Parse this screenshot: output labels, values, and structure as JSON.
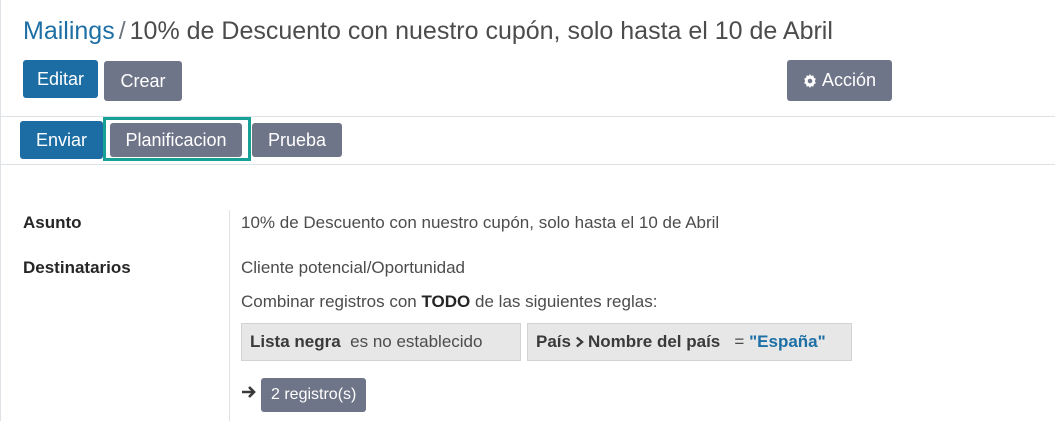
{
  "breadcrumb": {
    "parent": "Mailings",
    "separator": "/",
    "current": "10% de Descuento con nuestro cupón, solo hasta el 10 de Abril"
  },
  "control_panel": {
    "edit_label": "Editar",
    "create_label": "Crear",
    "action_label": "Acción",
    "action_icon": "gear-icon"
  },
  "statusbar": {
    "send_label": "Enviar",
    "schedule_label": "Planificacion",
    "test_label": "Prueba"
  },
  "form": {
    "subject_label": "Asunto",
    "subject_value": "10% de Descuento con nuestro cupón, solo hasta el 10 de Abril",
    "recipients_label": "Destinatarios",
    "recipients_model": "Cliente potencial/Oportunidad",
    "domain_intro_pre": "Combinar registros con",
    "domain_intro_bold": "TODO",
    "domain_intro_post": "de las siguientes reglas:",
    "rules": [
      {
        "field": "Lista negra",
        "operator": "es no establecido"
      },
      {
        "field_path": [
          "País",
          "Nombre del país"
        ],
        "operator": "=",
        "value": "\"España\""
      }
    ],
    "records_label": "2 registro(s)",
    "arrow_icon": "arrow-right-icon"
  },
  "colors": {
    "primary": "#1b6da3",
    "secondary": "#6f7588",
    "link": "#1d6fa5",
    "highlight": "#17a095"
  }
}
